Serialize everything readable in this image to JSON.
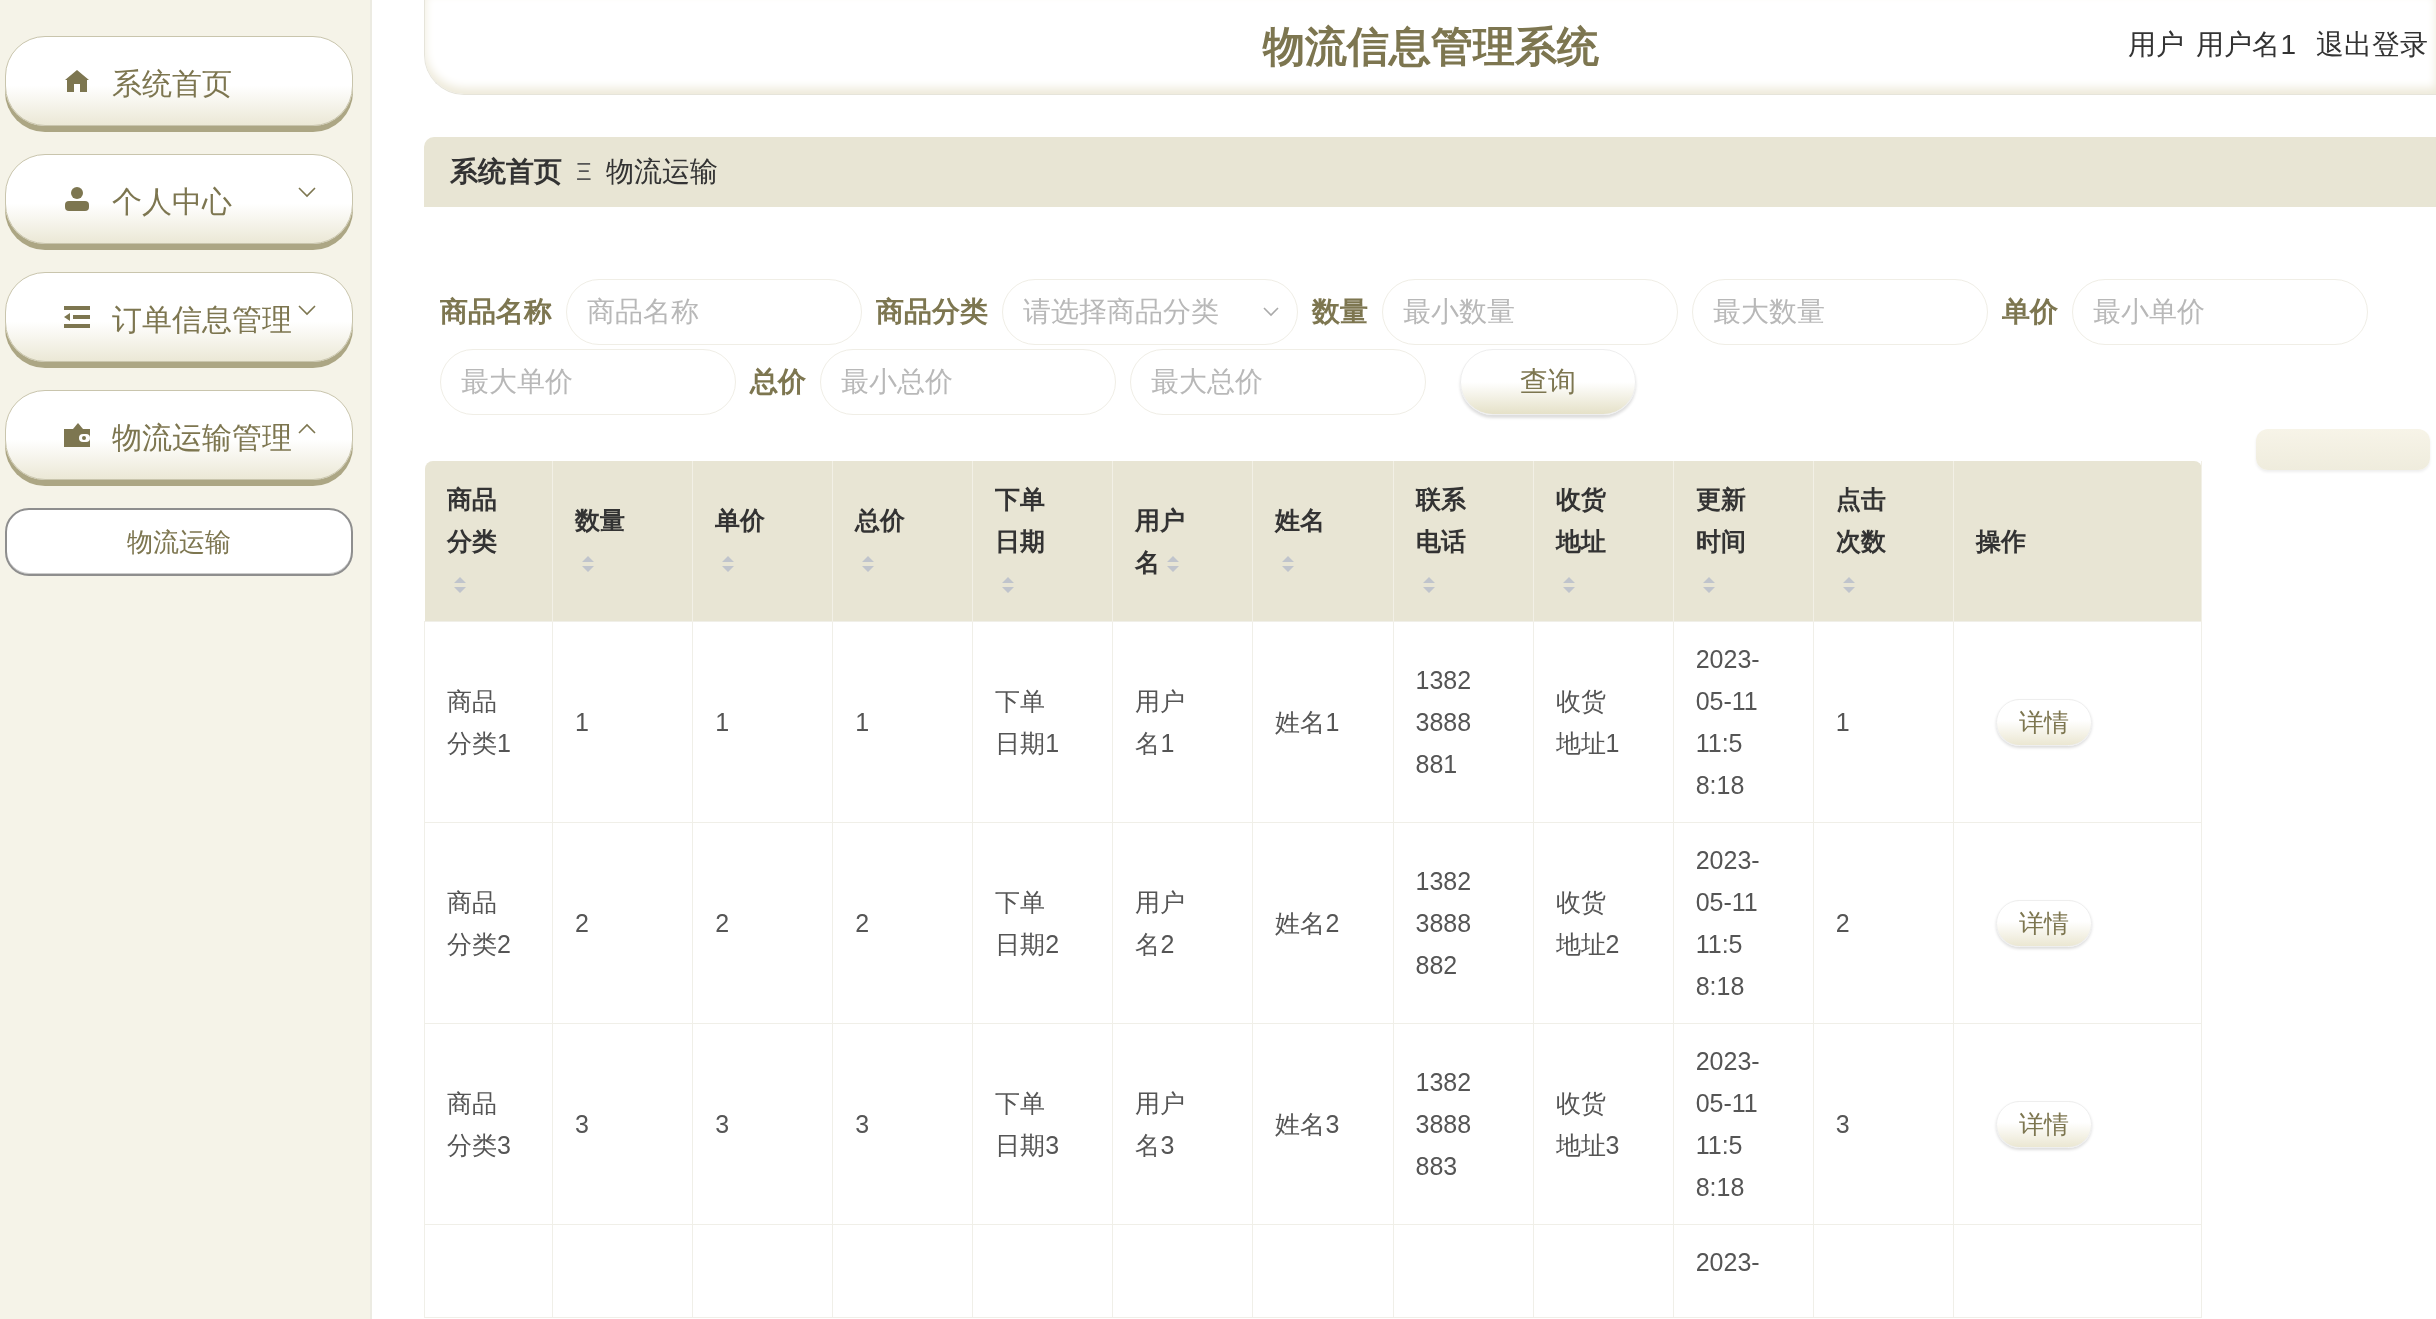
{
  "sidebar": {
    "items": [
      {
        "label": "系统首页",
        "kind": "link"
      },
      {
        "label": "个人中心",
        "kind": "menu",
        "expanded": false
      },
      {
        "label": "订单信息管理",
        "kind": "menu",
        "expanded": false
      },
      {
        "label": "物流运输管理",
        "kind": "menu",
        "expanded": true,
        "children": [
          {
            "label": "物流运输",
            "selected": true
          }
        ]
      }
    ]
  },
  "header": {
    "title": "物流信息管理系统",
    "role": "用户",
    "username": "用户名1",
    "logout": "退出登录"
  },
  "breadcrumb": {
    "items": [
      "系统首页",
      "物流运输"
    ],
    "separator": "Ξ"
  },
  "search": {
    "fields": [
      {
        "kind": "label",
        "text": "商品名称"
      },
      {
        "kind": "input",
        "placeholder": "商品名称"
      },
      {
        "kind": "label",
        "text": "商品分类"
      },
      {
        "kind": "select",
        "placeholder": "请选择商品分类"
      },
      {
        "kind": "label",
        "text": "数量"
      },
      {
        "kind": "input",
        "placeholder": "最小数量"
      },
      {
        "kind": "input",
        "placeholder": "最大数量"
      },
      {
        "kind": "label",
        "text": "单价"
      },
      {
        "kind": "input",
        "placeholder": "最小单价"
      },
      {
        "kind": "input",
        "placeholder": "最大单价"
      },
      {
        "kind": "label",
        "text": "总价"
      },
      {
        "kind": "input",
        "placeholder": "最小总价"
      },
      {
        "kind": "input",
        "placeholder": "最大总价"
      },
      {
        "kind": "button",
        "text": "查询"
      }
    ]
  },
  "table": {
    "columns": [
      {
        "label": "商品分类",
        "sortable": true
      },
      {
        "label": "数量",
        "sortable": true
      },
      {
        "label": "单价",
        "sortable": true
      },
      {
        "label": "总价",
        "sortable": true
      },
      {
        "label": "下单日期",
        "sortable": true
      },
      {
        "label": "用户名",
        "sortable": true
      },
      {
        "label": "姓名",
        "sortable": true
      },
      {
        "label": "联系电话",
        "sortable": true
      },
      {
        "label": "收货地址",
        "sortable": true
      },
      {
        "label": "更新时间",
        "sortable": true
      },
      {
        "label": "点击次数",
        "sortable": true
      },
      {
        "label": "操作",
        "sortable": false
      }
    ],
    "rows": [
      {
        "cells": [
          "商品分类1",
          "1",
          "1",
          "1",
          "下单日期1",
          "用户名1",
          "姓名1",
          "13823888881",
          "收货地址1",
          "2023-05-11 11:58:18",
          "1"
        ],
        "action": "详情"
      },
      {
        "cells": [
          "商品分类2",
          "2",
          "2",
          "2",
          "下单日期2",
          "用户名2",
          "姓名2",
          "13823888882",
          "收货地址2",
          "2023-05-11 11:58:18",
          "2"
        ],
        "action": "详情"
      },
      {
        "cells": [
          "商品分类3",
          "3",
          "3",
          "3",
          "下单日期3",
          "用户名3",
          "姓名3",
          "13823888883",
          "收货地址3",
          "2023-05-11 11:58:18",
          "3"
        ],
        "action": "详情"
      },
      {
        "cells": [
          null,
          null,
          null,
          null,
          null,
          null,
          null,
          null,
          null,
          "2023-",
          null
        ]
      }
    ]
  }
}
